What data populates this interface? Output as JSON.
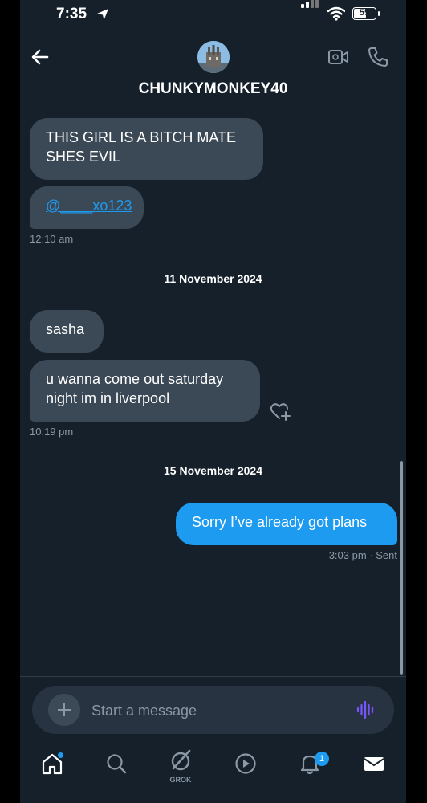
{
  "status_bar": {
    "time": "7:35",
    "battery": "55",
    "battery_level": 0.55
  },
  "header": {
    "username": "CHUNKYMONKEY40"
  },
  "messages": [
    {
      "text": "THIS GIRL IS A BITCH MATE SHES EVIL"
    },
    {
      "link_text": "@____xo123",
      "time": "12:10 am"
    },
    {
      "date_separator": "11 November 2024"
    },
    {
      "text": "sasha"
    },
    {
      "text": "u wanna come out saturday night im in liverpool",
      "time": "10:19 pm"
    },
    {
      "date_separator": "15 November 2024"
    },
    {
      "text": "Sorry I’ve already got plans",
      "time": "3:03 pm",
      "status": "· Sent"
    }
  ],
  "composer": {
    "placeholder": "Start a message"
  },
  "bottom_nav": {
    "grok_label": "GROK",
    "notifications_count": "1"
  },
  "colors": {
    "background": "#15202b",
    "incoming_bubble": "#3b4956",
    "outgoing_bubble": "#1d9bf0",
    "accent": "#1d9bf0",
    "voice_accent": "#7856ff"
  }
}
